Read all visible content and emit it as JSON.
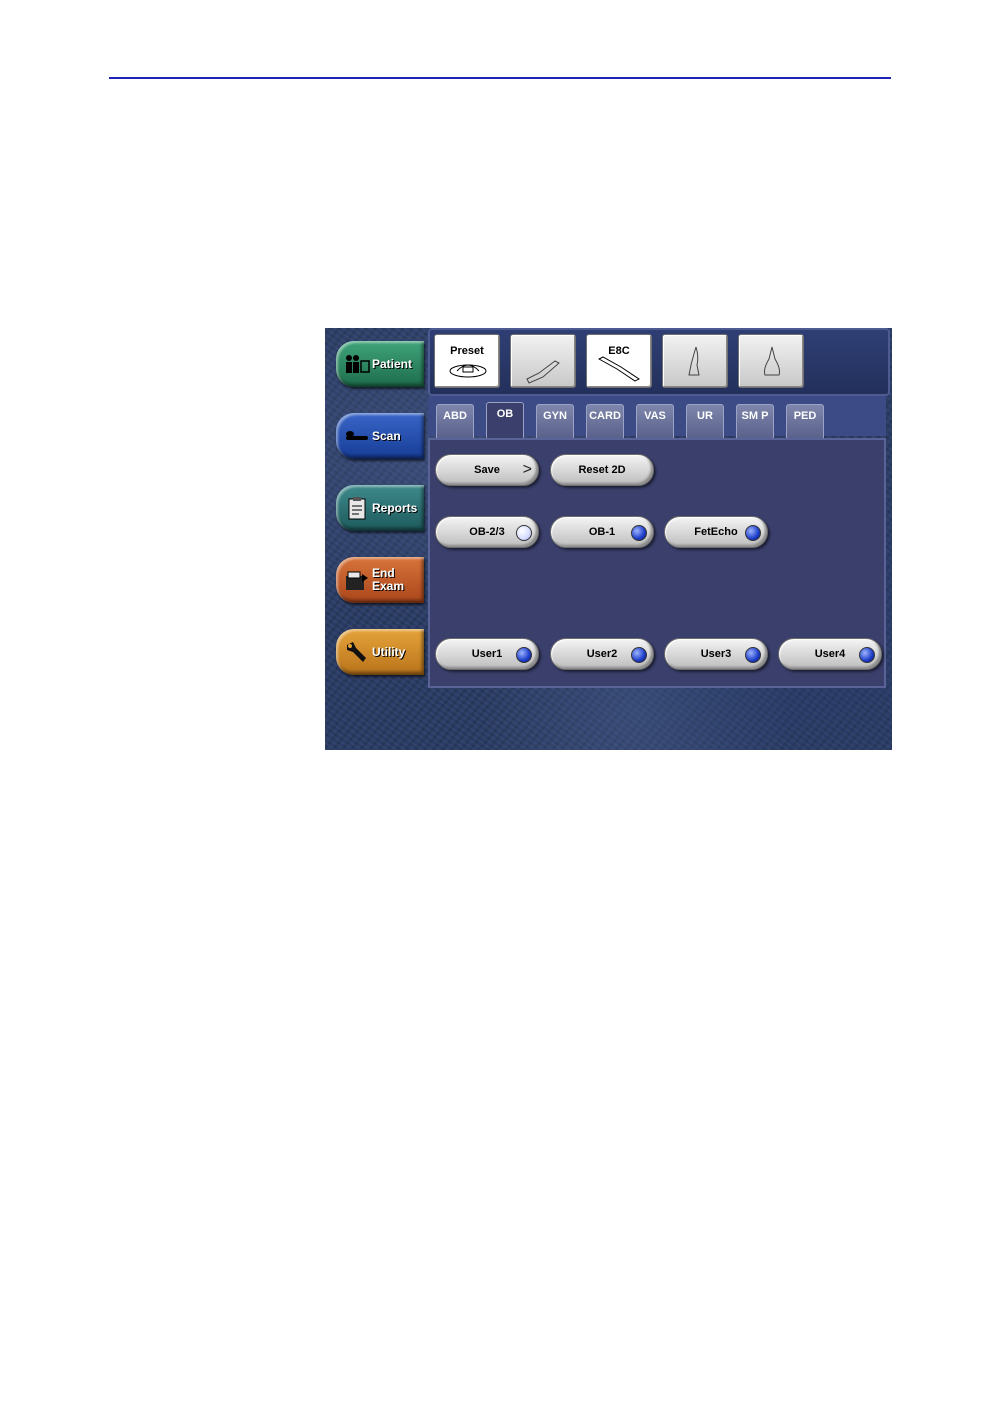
{
  "nav": {
    "patient": "Patient",
    "scan": "Scan",
    "reports": "Reports",
    "end_exam_1": "End",
    "end_exam_2": "Exam",
    "utility": "Utility"
  },
  "probes": [
    {
      "label": "Preset",
      "icon": "preset-probe-icon",
      "selected": true
    },
    {
      "label": "",
      "icon": "linear-probe-icon",
      "selected": false
    },
    {
      "label": "E8C",
      "icon": "endocavity-probe-icon",
      "selected": true
    },
    {
      "label": "",
      "icon": "sector-probe-icon",
      "selected": false
    },
    {
      "label": "",
      "icon": "convex-probe-icon",
      "selected": false
    }
  ],
  "tabs": [
    "ABD",
    "OB",
    "GYN",
    "CARD",
    "VAS",
    "UR",
    "SM P",
    "PED"
  ],
  "active_tab": "OB",
  "actions": {
    "save": "Save",
    "reset": "Reset 2D"
  },
  "presets": [
    {
      "label": "OB-2/3",
      "on": false
    },
    {
      "label": "OB-1",
      "on": true
    },
    {
      "label": "FetEcho",
      "on": true
    }
  ],
  "users": [
    {
      "label": "User1"
    },
    {
      "label": "User2"
    },
    {
      "label": "User3"
    },
    {
      "label": "User4"
    }
  ],
  "colors": {
    "rule": "#1a22b8",
    "panel": "#3a3f6b",
    "led_on": "#1c3cc8"
  }
}
